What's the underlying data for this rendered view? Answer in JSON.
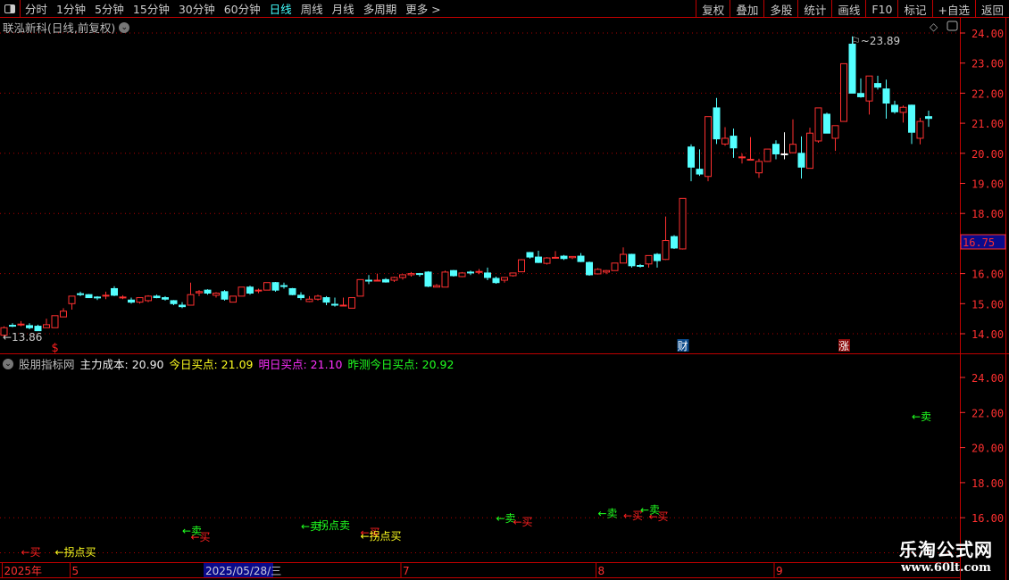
{
  "topbar": {
    "periods": [
      "分时",
      "1分钟",
      "5分钟",
      "15分钟",
      "30分钟",
      "60分钟",
      "日线",
      "周线",
      "月线",
      "多周期",
      "更多 >"
    ],
    "active_period": "日线",
    "tools": [
      "复权",
      "叠加",
      "多股",
      "统计",
      "画线",
      "F10",
      "标记",
      "+自选",
      "返回"
    ]
  },
  "chart_title": "联泓新科(日线,前复权)",
  "indicator": {
    "name": "股朋指标网",
    "main_cost": "主力成本: 20.90",
    "today_buy": "今日买点: 21.09",
    "tomorrow_buy": "明日买点: 21.10",
    "predicted_today_buy": "昨测今日买点: 20.92"
  },
  "colors": {
    "up": "#ff3030",
    "down": "#54ffff",
    "buy": "#ff2020",
    "sell": "#20ff20",
    "turn": "#ffff20",
    "axis": "#ff3030",
    "grid": "#b00000"
  },
  "chart_data": [
    {
      "type": "candlestick",
      "title": "联泓新科(日线,前复权)",
      "ylim": [
        13.6,
        24.4
      ],
      "yticks": [
        "24.00",
        "23.00",
        "22.00",
        "21.00",
        "20.00",
        "19.00",
        "18.00",
        "17.00",
        "16.00",
        "15.00",
        "14.00"
      ],
      "current_price_label": "16.75",
      "low_label": "13.86",
      "high_label": "23.89",
      "markers": [
        {
          "index": 6,
          "text": "$"
        },
        {
          "index": 80,
          "text": "财"
        },
        {
          "index": 99,
          "text": "涨"
        }
      ],
      "ohlc": [
        [
          13.95,
          14.25,
          13.86,
          14.2
        ],
        [
          14.28,
          14.35,
          14.22,
          14.27
        ],
        [
          14.32,
          14.42,
          14.25,
          14.32
        ],
        [
          14.27,
          14.35,
          14.15,
          14.2
        ],
        [
          14.25,
          14.3,
          14.1,
          14.1
        ],
        [
          14.2,
          14.5,
          14.2,
          14.3
        ],
        [
          14.2,
          14.6,
          14.2,
          14.6
        ],
        [
          14.56,
          14.85,
          14.56,
          14.75
        ],
        [
          15.0,
          15.25,
          14.8,
          15.25
        ],
        [
          15.32,
          15.4,
          15.25,
          15.33
        ],
        [
          15.3,
          15.32,
          15.2,
          15.2
        ],
        [
          15.22,
          15.25,
          15.12,
          15.2
        ],
        [
          15.28,
          15.4,
          15.15,
          15.28
        ],
        [
          15.5,
          15.58,
          15.25,
          15.28
        ],
        [
          15.22,
          15.28,
          15.15,
          15.22
        ],
        [
          15.12,
          15.2,
          15.0,
          15.05
        ],
        [
          15.05,
          15.2,
          15.0,
          15.2
        ],
        [
          15.1,
          15.28,
          15.05,
          15.25
        ],
        [
          15.25,
          15.3,
          15.18,
          15.2
        ],
        [
          15.2,
          15.25,
          15.1,
          15.15
        ],
        [
          15.1,
          15.12,
          14.95,
          15.0
        ],
        [
          14.95,
          15.05,
          14.85,
          14.9
        ],
        [
          14.95,
          15.7,
          14.95,
          15.3
        ],
        [
          15.36,
          15.45,
          15.25,
          15.4
        ],
        [
          15.45,
          15.48,
          15.3,
          15.35
        ],
        [
          15.28,
          15.38,
          15.2,
          15.35
        ],
        [
          15.4,
          15.45,
          15.1,
          15.15
        ],
        [
          15.05,
          15.25,
          15.05,
          15.25
        ],
        [
          15.25,
          15.55,
          15.25,
          15.55
        ],
        [
          15.55,
          15.6,
          15.3,
          15.35
        ],
        [
          15.43,
          15.5,
          15.35,
          15.45
        ],
        [
          15.45,
          15.7,
          15.45,
          15.7
        ],
        [
          15.7,
          15.72,
          15.4,
          15.45
        ],
        [
          15.6,
          15.7,
          15.5,
          15.6
        ],
        [
          15.5,
          15.52,
          15.28,
          15.3
        ],
        [
          15.28,
          15.38,
          15.12,
          15.2
        ],
        [
          15.07,
          15.25,
          15.05,
          15.15
        ],
        [
          15.15,
          15.3,
          15.1,
          15.25
        ],
        [
          15.2,
          15.25,
          14.95,
          15.05
        ],
        [
          14.98,
          15.2,
          14.9,
          14.98
        ],
        [
          14.93,
          15.2,
          14.93,
          14.95
        ],
        [
          14.85,
          15.2,
          14.85,
          15.2
        ],
        [
          15.25,
          15.8,
          15.25,
          15.8
        ],
        [
          15.78,
          15.95,
          15.65,
          15.78
        ],
        [
          15.78,
          16.0,
          15.75,
          15.78
        ],
        [
          15.8,
          15.85,
          15.7,
          15.72
        ],
        [
          15.78,
          15.9,
          15.72,
          15.87
        ],
        [
          15.87,
          15.98,
          15.8,
          15.96
        ],
        [
          15.96,
          16.05,
          15.9,
          16.0
        ],
        [
          16.0,
          16.02,
          15.9,
          16.0
        ],
        [
          16.05,
          16.08,
          15.55,
          15.58
        ],
        [
          15.55,
          15.65,
          15.55,
          15.6
        ],
        [
          15.55,
          16.1,
          15.55,
          16.05
        ],
        [
          16.1,
          16.12,
          15.9,
          15.93
        ],
        [
          15.9,
          16.05,
          15.88,
          16.02
        ],
        [
          16.05,
          16.1,
          15.95,
          16.05
        ],
        [
          16.07,
          16.15,
          15.98,
          16.07
        ],
        [
          16.02,
          16.2,
          15.78,
          15.87
        ],
        [
          15.84,
          15.9,
          15.66,
          15.7
        ],
        [
          15.78,
          15.87,
          15.7,
          15.87
        ],
        [
          15.93,
          16.02,
          15.9,
          16.02
        ],
        [
          16.06,
          16.48,
          16.05,
          16.46
        ],
        [
          16.7,
          16.72,
          16.5,
          16.55
        ],
        [
          16.55,
          16.76,
          16.35,
          16.37
        ],
        [
          16.34,
          16.55,
          16.3,
          16.52
        ],
        [
          16.52,
          16.75,
          16.5,
          16.54
        ],
        [
          16.58,
          16.62,
          16.45,
          16.5
        ],
        [
          16.53,
          16.57,
          16.48,
          16.57
        ],
        [
          16.58,
          16.68,
          16.38,
          16.4
        ],
        [
          16.37,
          16.4,
          15.93,
          15.96
        ],
        [
          15.99,
          16.18,
          15.97,
          16.14
        ],
        [
          16.05,
          16.12,
          15.98,
          16.1
        ],
        [
          16.1,
          16.35,
          16.1,
          16.35
        ],
        [
          16.35,
          16.87,
          16.35,
          16.64
        ],
        [
          16.64,
          16.66,
          16.2,
          16.26
        ],
        [
          16.26,
          16.32,
          16.2,
          16.27
        ],
        [
          16.32,
          16.6,
          16.2,
          16.6
        ],
        [
          16.64,
          16.68,
          16.2,
          16.43
        ],
        [
          16.47,
          17.9,
          16.45,
          17.1
        ],
        [
          17.23,
          17.28,
          16.82,
          16.85
        ],
        [
          16.82,
          18.5,
          16.8,
          18.5
        ],
        [
          20.21,
          20.3,
          19.07,
          19.54
        ],
        [
          19.47,
          20.13,
          19.25,
          19.31
        ],
        [
          19.23,
          21.22,
          19.07,
          21.22
        ],
        [
          21.51,
          21.84,
          20.31,
          20.48
        ],
        [
          20.31,
          20.87,
          20.25,
          20.5
        ],
        [
          20.57,
          20.82,
          19.85,
          20.18
        ],
        [
          19.86,
          19.99,
          19.66,
          19.88
        ],
        [
          19.8,
          20.54,
          19.78,
          19.8
        ],
        [
          19.35,
          19.82,
          19.18,
          19.73
        ],
        [
          19.73,
          20.14,
          19.72,
          20.14
        ],
        [
          20.3,
          20.43,
          19.8,
          19.98
        ],
        [
          19.98,
          20.7,
          19.8,
          19.98
        ],
        [
          20.02,
          21.13,
          20.0,
          20.3
        ],
        [
          20.0,
          20.56,
          19.16,
          19.54
        ],
        [
          19.5,
          20.85,
          19.5,
          20.67
        ],
        [
          20.41,
          21.51,
          20.35,
          21.51
        ],
        [
          21.3,
          21.35,
          20.67,
          20.67
        ],
        [
          20.5,
          20.92,
          20.08,
          20.92
        ],
        [
          21.06,
          22.98,
          21.06,
          22.98
        ],
        [
          23.63,
          23.89,
          22.0,
          22.0
        ],
        [
          21.99,
          22.49,
          21.85,
          21.88
        ],
        [
          21.74,
          22.57,
          21.29,
          22.57
        ],
        [
          22.32,
          22.58,
          22.12,
          22.2
        ],
        [
          22.14,
          22.45,
          21.15,
          21.67
        ],
        [
          21.6,
          21.75,
          21.32,
          21.38
        ],
        [
          21.36,
          21.59,
          21.02,
          21.53
        ],
        [
          21.6,
          21.62,
          20.31,
          20.7
        ],
        [
          20.5,
          21.18,
          20.3,
          21.06
        ],
        [
          21.22,
          21.42,
          20.88,
          21.16
        ]
      ]
    },
    {
      "type": "signals",
      "title": "股朋指标网",
      "ylim": [
        13.5,
        24.5
      ],
      "yticks": [
        "24.00",
        "22.00",
        "20.00",
        "18.00",
        "16.00"
      ],
      "signals": [
        {
          "index": 2,
          "value": 14.08,
          "text": "←买",
          "kind": "buy"
        },
        {
          "index": 6,
          "value": 14.08,
          "text": "←拐点买",
          "kind": "turn"
        },
        {
          "index": 21,
          "value": 15.3,
          "text": "←卖",
          "kind": "sell"
        },
        {
          "index": 22,
          "value": 14.94,
          "text": "←买",
          "kind": "buy"
        },
        {
          "index": 35,
          "value": 15.55,
          "text": "←卖",
          "kind": "sell"
        },
        {
          "index": 37,
          "value": 15.6,
          "text": "拐点卖",
          "kind": "sell"
        },
        {
          "index": 42,
          "value": 15.2,
          "text": "←买",
          "kind": "buy"
        },
        {
          "index": 42,
          "value": 15.0,
          "text": "←拐点买",
          "kind": "turn"
        },
        {
          "index": 58,
          "value": 16.0,
          "text": "←卖",
          "kind": "sell"
        },
        {
          "index": 60,
          "value": 15.8,
          "text": "←买",
          "kind": "buy"
        },
        {
          "index": 70,
          "value": 16.3,
          "text": "←卖",
          "kind": "sell"
        },
        {
          "index": 73,
          "value": 16.16,
          "text": "←买",
          "kind": "buy"
        },
        {
          "index": 75,
          "value": 16.5,
          "text": "←卖",
          "kind": "sell"
        },
        {
          "index": 76,
          "value": 16.1,
          "text": "←买",
          "kind": "buy"
        },
        {
          "index": 107,
          "value": 21.8,
          "text": "←卖",
          "kind": "sell"
        }
      ]
    }
  ],
  "date_axis": {
    "labels": [
      {
        "index": 0,
        "text": "2025年"
      },
      {
        "index": 8,
        "text": "5"
      },
      {
        "index": 47,
        "text": "7"
      },
      {
        "index": 70,
        "text": "8"
      },
      {
        "index": 91,
        "text": "9"
      }
    ],
    "cursor_date": "2025/05/28/三"
  },
  "watermark": {
    "name": "乐淘公式网",
    "url": "www.60lt.com"
  }
}
